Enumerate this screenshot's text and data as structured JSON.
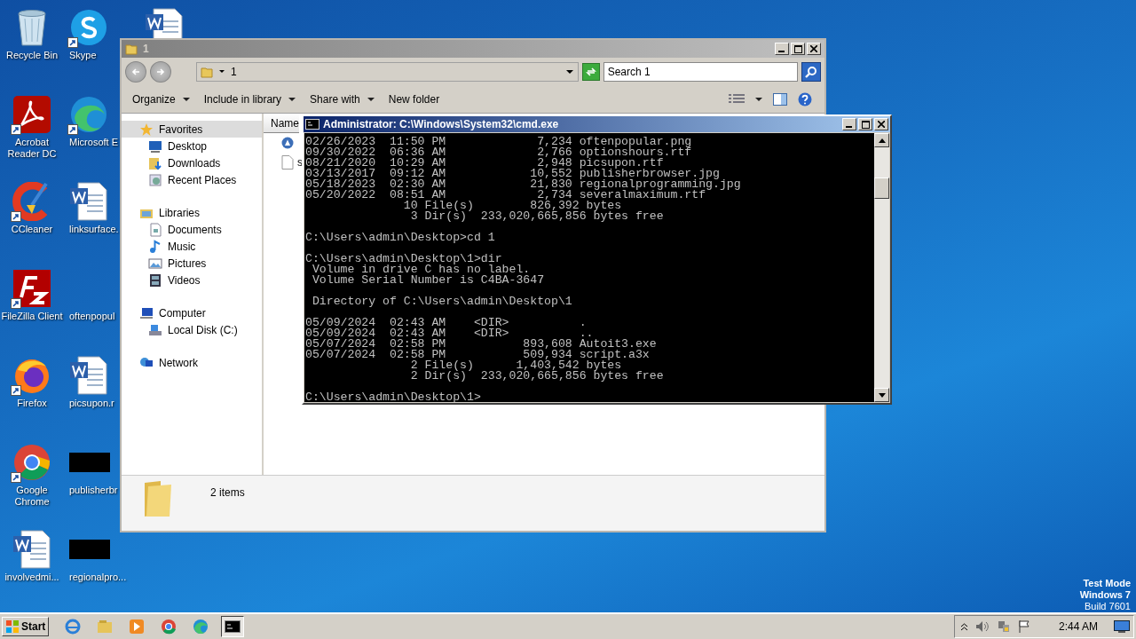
{
  "desktop_icons": [
    {
      "label": "Recycle Bin",
      "kind": "recycle",
      "shortcut": false
    },
    {
      "label": "Skype",
      "kind": "skype",
      "shortcut": true
    },
    {
      "label": "Acrobat Reader DC",
      "kind": "acrobat",
      "shortcut": true
    },
    {
      "label": "Microsoft E",
      "kind": "edge",
      "shortcut": true
    },
    {
      "label": "CCleaner",
      "kind": "ccleaner",
      "shortcut": true
    },
    {
      "label": "linksurface.",
      "kind": "word",
      "shortcut": false
    },
    {
      "label": "FileZilla Client",
      "kind": "filezilla",
      "shortcut": true
    },
    {
      "label": "oftenpopul",
      "kind": "blank",
      "shortcut": false
    },
    {
      "label": "Firefox",
      "kind": "firefox",
      "shortcut": true
    },
    {
      "label": "picsupon.r",
      "kind": "word",
      "shortcut": false
    },
    {
      "label": "Google Chrome",
      "kind": "chrome",
      "shortcut": true
    },
    {
      "label": "publisherbr",
      "kind": "black",
      "shortcut": false
    },
    {
      "label": "involvedmi...",
      "kind": "word",
      "shortcut": false
    },
    {
      "label": "regionalpro...",
      "kind": "black",
      "shortcut": false
    }
  ],
  "desktop_partial_icon": {
    "kind": "word"
  },
  "explorer": {
    "title": "1",
    "address": "1",
    "search": {
      "placeholder": "Search 1"
    },
    "toolbar": [
      {
        "label": "Organize",
        "dropdown": true
      },
      {
        "label": "Include in library",
        "dropdown": true
      },
      {
        "label": "Share with",
        "dropdown": true
      },
      {
        "label": "New folder",
        "dropdown": false
      }
    ],
    "sidebar": [
      {
        "label": "Favorites",
        "kind": "star",
        "selected": true,
        "children": [
          {
            "label": "Desktop",
            "kind": "desktop",
            "selected": false
          },
          {
            "label": "Downloads",
            "kind": "downloads",
            "selected": false
          },
          {
            "label": "Recent Places",
            "kind": "recent",
            "selected": false
          }
        ]
      },
      {
        "label": "Libraries",
        "kind": "libraries",
        "selected": false,
        "children": [
          {
            "label": "Documents",
            "kind": "documents",
            "selected": false
          },
          {
            "label": "Music",
            "kind": "music",
            "selected": false
          },
          {
            "label": "Pictures",
            "kind": "pictures",
            "selected": false
          },
          {
            "label": "Videos",
            "kind": "videos",
            "selected": false
          }
        ]
      },
      {
        "label": "Computer",
        "kind": "computer",
        "selected": false,
        "children": [
          {
            "label": "Local Disk (C:)",
            "kind": "disk",
            "selected": false
          }
        ]
      },
      {
        "label": "Network",
        "kind": "network",
        "selected": false
      }
    ],
    "columns": [
      "Name"
    ],
    "files": [
      {
        "kind": "autoit"
      },
      {
        "name": "s",
        "kind": "file"
      }
    ],
    "status": "2 items"
  },
  "cmd": {
    "title": "Administrator: C:\\Windows\\System32\\cmd.exe",
    "blocks": [
      [
        "02/26/2023  11:50 PM             7,234 oftenpopular.png",
        "09/30/2022  06:36 AM             2,766 optionshours.rtf",
        "08/21/2020  10:29 AM             2,948 picsupon.rtf",
        "03/13/2017  09:12 AM            10,552 publisherbrowser.jpg",
        "05/18/2023  02:30 AM            21,830 regionalprogramming.jpg",
        "05/20/2022  08:51 AM             2,734 severalmaximum.rtf",
        "              10 File(s)        826,392 bytes",
        "               3 Dir(s)  233,020,665,856 bytes free"
      ],
      [
        "C:\\Users\\admin\\Desktop>cd 1"
      ],
      [
        "C:\\Users\\admin\\Desktop\\1>dir",
        " Volume in drive C has no label.",
        " Volume Serial Number is C4BA-3647"
      ],
      [
        " Directory of C:\\Users\\admin\\Desktop\\1"
      ],
      [
        "05/09/2024  02:43 AM    <DIR>          .",
        "05/09/2024  02:43 AM    <DIR>          ..",
        "05/07/2024  02:58 PM           893,608 Autoit3.exe",
        "05/07/2024  02:58 PM           509,934 script.a3x",
        "               2 File(s)      1,403,542 bytes",
        "               2 Dir(s)  233,020,665,856 bytes free"
      ],
      [
        "C:\\Users\\admin\\Desktop\\1>"
      ]
    ]
  },
  "watermark_text": [
    "Test Mode",
    "Windows 7",
    "Build 7601"
  ],
  "taskbar": {
    "start": "Start",
    "apps": [
      {
        "kind": "ie",
        "selected": false
      },
      {
        "kind": "explorer",
        "selected": false
      },
      {
        "kind": "media",
        "selected": false
      },
      {
        "kind": "chrome",
        "selected": false
      },
      {
        "kind": "edge",
        "selected": false
      },
      {
        "kind": "cmd",
        "selected": true
      }
    ],
    "clock": "2:44 AM"
  }
}
